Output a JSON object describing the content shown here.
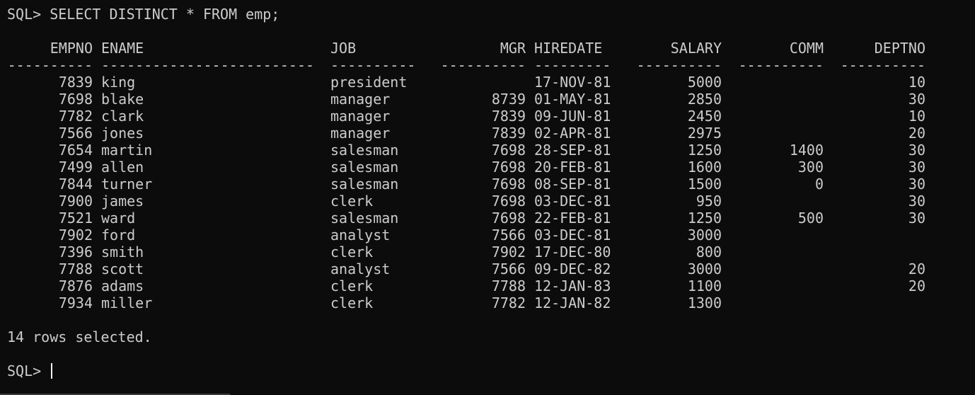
{
  "prompt": "SQL>",
  "command": "SELECT DISTINCT * FROM emp;",
  "columns": {
    "empno": "EMPNO",
    "ename": "ENAME",
    "job": "JOB",
    "mgr": "MGR",
    "hiredate": "HIREDATE",
    "salary": "SALARY",
    "comm": "COMM",
    "deptno": "DEPTNO"
  },
  "dashes": {
    "empno": "----------",
    "ename": "-------------------------",
    "job": "----------",
    "mgr": "----------",
    "hiredate": "---------",
    "salary": "----------",
    "comm": "----------",
    "deptno": "----------"
  },
  "rows": [
    {
      "empno": "7839",
      "ename": "king",
      "job": "president",
      "mgr": "",
      "hiredate": "17-NOV-81",
      "salary": "5000",
      "comm": "",
      "deptno": "10"
    },
    {
      "empno": "7698",
      "ename": "blake",
      "job": "manager",
      "mgr": "8739",
      "hiredate": "01-MAY-81",
      "salary": "2850",
      "comm": "",
      "deptno": "30"
    },
    {
      "empno": "7782",
      "ename": "clark",
      "job": "manager",
      "mgr": "7839",
      "hiredate": "09-JUN-81",
      "salary": "2450",
      "comm": "",
      "deptno": "10"
    },
    {
      "empno": "7566",
      "ename": "jones",
      "job": "manager",
      "mgr": "7839",
      "hiredate": "02-APR-81",
      "salary": "2975",
      "comm": "",
      "deptno": "20"
    },
    {
      "empno": "7654",
      "ename": "martin",
      "job": "salesman",
      "mgr": "7698",
      "hiredate": "28-SEP-81",
      "salary": "1250",
      "comm": "1400",
      "deptno": "30"
    },
    {
      "empno": "7499",
      "ename": "allen",
      "job": "salesman",
      "mgr": "7698",
      "hiredate": "20-FEB-81",
      "salary": "1600",
      "comm": "300",
      "deptno": "30"
    },
    {
      "empno": "7844",
      "ename": "turner",
      "job": "salesman",
      "mgr": "7698",
      "hiredate": "08-SEP-81",
      "salary": "1500",
      "comm": "0",
      "deptno": "30"
    },
    {
      "empno": "7900",
      "ename": "james",
      "job": "clerk",
      "mgr": "7698",
      "hiredate": "03-DEC-81",
      "salary": "950",
      "comm": "",
      "deptno": "30"
    },
    {
      "empno": "7521",
      "ename": "ward",
      "job": "salesman",
      "mgr": "7698",
      "hiredate": "22-FEB-81",
      "salary": "1250",
      "comm": "500",
      "deptno": "30"
    },
    {
      "empno": "7902",
      "ename": "ford",
      "job": "analyst",
      "mgr": "7566",
      "hiredate": "03-DEC-81",
      "salary": "3000",
      "comm": "",
      "deptno": ""
    },
    {
      "empno": "7396",
      "ename": "smith",
      "job": "clerk",
      "mgr": "7902",
      "hiredate": "17-DEC-80",
      "salary": "800",
      "comm": "",
      "deptno": ""
    },
    {
      "empno": "7788",
      "ename": "scott",
      "job": "analyst",
      "mgr": "7566",
      "hiredate": "09-DEC-82",
      "salary": "3000",
      "comm": "",
      "deptno": "20"
    },
    {
      "empno": "7876",
      "ename": "adams",
      "job": "clerk",
      "mgr": "7788",
      "hiredate": "12-JAN-83",
      "salary": "1100",
      "comm": "",
      "deptno": "20"
    },
    {
      "empno": "7934",
      "ename": "miller",
      "job": "clerk",
      "mgr": "7782",
      "hiredate": "12-JAN-82",
      "salary": "1300",
      "comm": "",
      "deptno": ""
    }
  ],
  "footer": "14 rows selected.",
  "final_prompt": "SQL>"
}
